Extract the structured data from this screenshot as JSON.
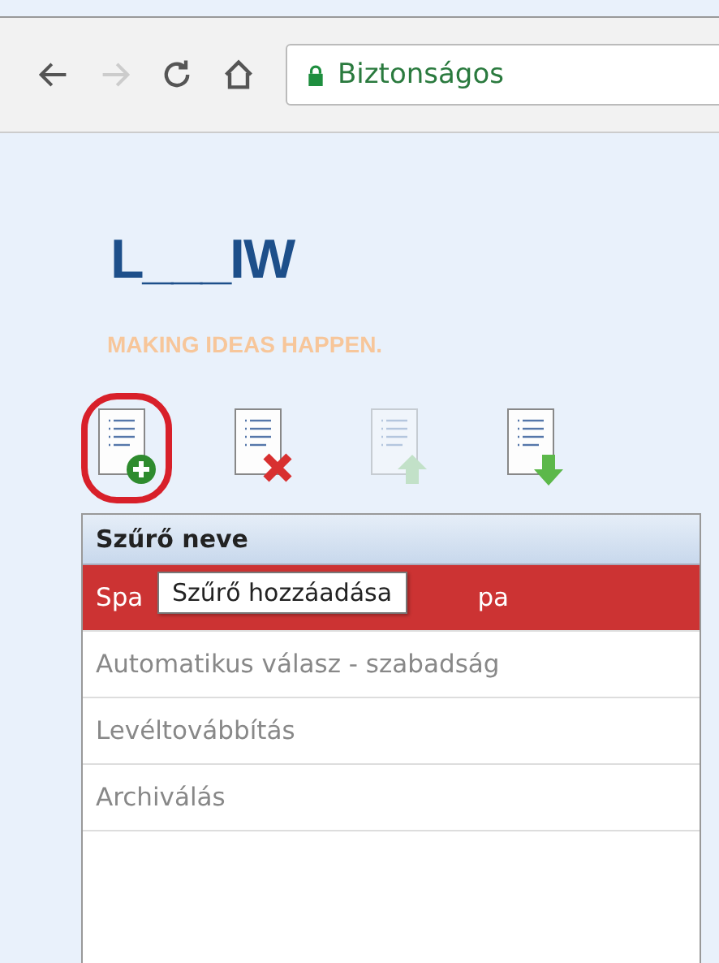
{
  "browser": {
    "back_disabled": false,
    "forward_disabled": true,
    "address": "Biztonságos"
  },
  "logo": {
    "text": "L___IW",
    "tagline": "MAKING IDEAS HAPPEN."
  },
  "toolbar": [
    {
      "kind": "add",
      "disabled": false,
      "highlighted": true
    },
    {
      "kind": "delete",
      "disabled": false,
      "highlighted": false
    },
    {
      "kind": "up",
      "disabled": true,
      "highlighted": false
    },
    {
      "kind": "down",
      "disabled": false,
      "highlighted": false
    }
  ],
  "table": {
    "column": "Szűrő neve",
    "rows": [
      {
        "text": "Spa",
        "text_end": "pa",
        "selected": true
      },
      {
        "text": "Automatikus válasz - szabadság",
        "selected": false
      },
      {
        "text": "Levéltovábbítás",
        "selected": false
      },
      {
        "text": "Archiválás",
        "selected": false
      }
    ]
  },
  "tooltip": "Szűrő hozzáadása"
}
